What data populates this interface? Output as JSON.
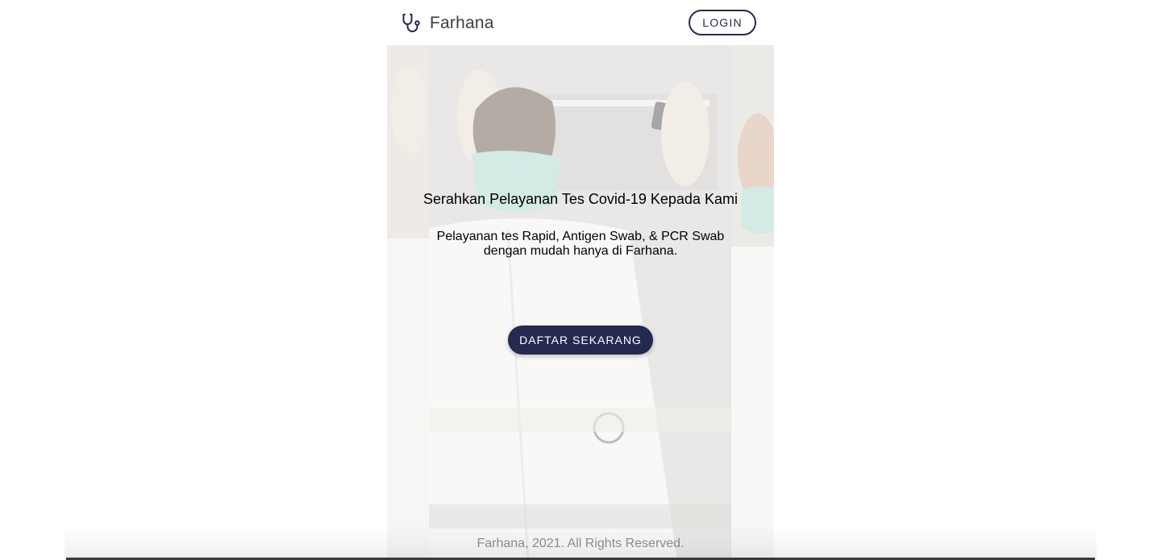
{
  "navbar": {
    "brand_name": "Farhana",
    "brand_icon": "stethoscope-icon",
    "login_label": "LOGIN"
  },
  "hero": {
    "title": "Serahkan Pelayanan Tes Covid-19 Kepada Kami",
    "subtitle_line1": "Pelayanan tes Rapid, Antigen Swab, & PCR Swab",
    "subtitle_line2": "dengan mudah hanya di Farhana.",
    "cta_label": "DAFTAR SEKARANG"
  },
  "footer": {
    "copyright": "Farhana, 2021. All Rights Reserved."
  },
  "colors": {
    "primary": "#262950",
    "text": "#000000",
    "footer_text": "#8a8a96",
    "background": "#ffffff"
  }
}
